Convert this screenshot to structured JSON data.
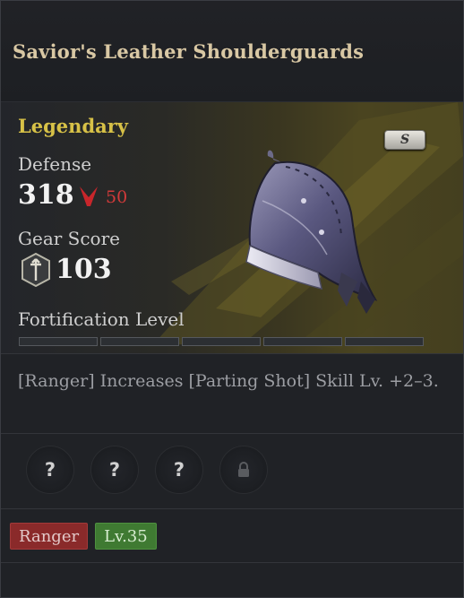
{
  "item": {
    "name": "Savior's Leather Shoulderguards",
    "rarity": "Legendary",
    "tier": "S",
    "stats": {
      "defense_label": "Defense",
      "defense_value": "318",
      "defense_diff": "50",
      "gear_score_label": "Gear Score",
      "gear_score_value": "103"
    },
    "fortification": {
      "label": "Fortification Level",
      "level": 0,
      "max": 5
    },
    "description": "[Ranger] Increases [Parting Shot] Skill Lv. +2–3.",
    "sockets": [
      {
        "state": "unknown",
        "glyph": "?"
      },
      {
        "state": "unknown",
        "glyph": "?"
      },
      {
        "state": "unknown",
        "glyph": "?"
      },
      {
        "state": "locked",
        "icon": "lock-icon"
      }
    ],
    "tags": {
      "class": "Ranger",
      "level": "Lv.35"
    }
  },
  "colors": {
    "rarity": "#d7c147",
    "decrease": "#d23a3a",
    "class_tag": "#8a2a2a",
    "level_tag": "#3f7a32"
  }
}
